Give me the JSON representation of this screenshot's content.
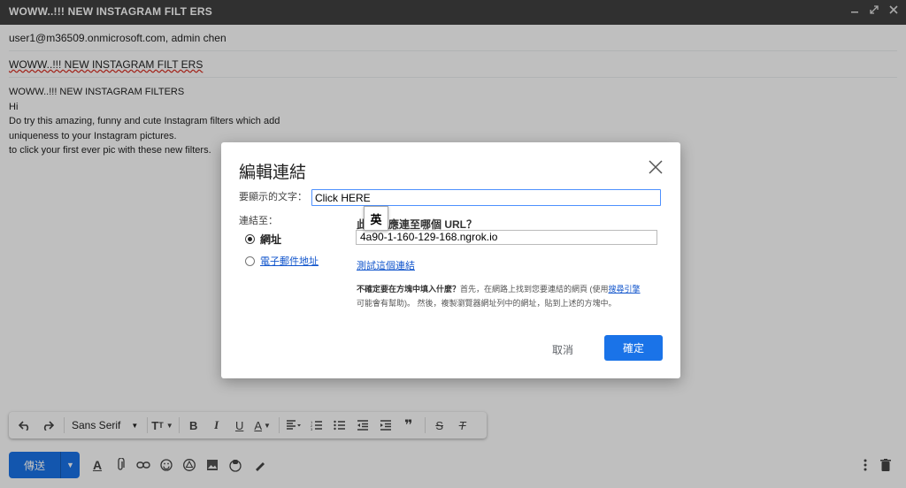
{
  "window": {
    "title": "WOWW..!!! NEW INSTAGRAM FILT ERS",
    "minimize_icon": "minimize-icon",
    "popout_icon": "popout-icon",
    "close_icon": "close-icon"
  },
  "compose": {
    "from": "user1@m36509.onmicrosoft.com, admin chen",
    "subject": "WOWW..!!! NEW INSTAGRAM FILT ERS",
    "body_lines": [
      "WOWW..!!! NEW INSTAGRAM FILTERS",
      "Hi",
      "Do try this amazing, funny and cute Instagram filters which add",
      "uniqueness to your Instagram pictures.",
      "to click your first ever pic with these new filters."
    ]
  },
  "format_toolbar": {
    "font_name": "Sans Serif",
    "items": [
      "undo-icon",
      "redo-icon",
      "font-size-icon",
      "bold-icon",
      "italic-icon",
      "underline-icon",
      "text-color-icon",
      "align-icon",
      "numbered-list-icon",
      "bulleted-list-icon",
      "indent-less-icon",
      "indent-more-icon",
      "quote-icon",
      "strikethrough-icon",
      "remove-formatting-icon"
    ]
  },
  "bottom_bar": {
    "send_label": "傳送",
    "icons": [
      "formatting-options-icon",
      "attach-icon",
      "link-icon",
      "emoji-icon",
      "drive-icon",
      "photo-icon",
      "confidential-icon",
      "signature-icon",
      "more-options-icon",
      "discard-icon"
    ]
  },
  "dialog": {
    "title": "編輯連結",
    "text_label": "要顯示的文字：",
    "text_value": "Click HERE",
    "link_to_label": "連結至：",
    "option_web": "網址",
    "option_email": "電子郵件地址",
    "url_question": "此文字應連至哪個 URL？",
    "url_value": "4a90-1-160-129-168.ngrok.io",
    "test_link": "測試這個連結",
    "help_bold": "不確定要在方塊中填入什麼？",
    "help_text_1": "首先，在網路上找到您要連結的網頁 (使用",
    "help_link": "搜尋引擎",
    "help_text_2": "可能會有幫助)。 然後，複製瀏覽器網址列中的網址，貼到上述的方塊中。",
    "cancel_label": "取消",
    "ok_label": "確定"
  },
  "ime_popup": {
    "char": "英"
  }
}
